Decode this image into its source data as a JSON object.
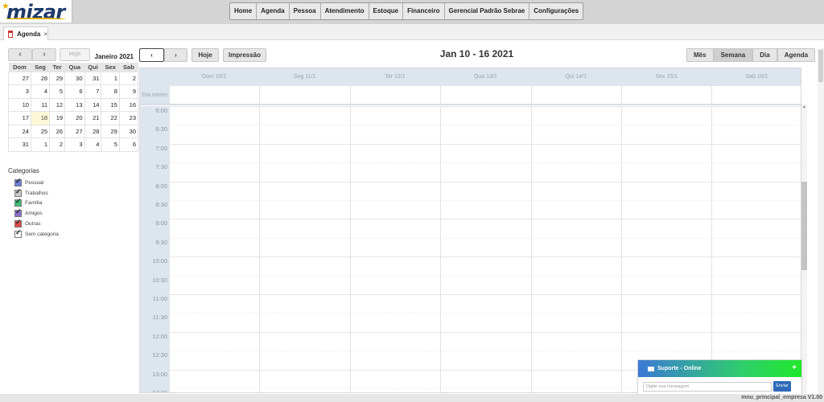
{
  "logo": {
    "text": "mizar"
  },
  "menu": [
    "Home",
    "Agenda",
    "Pessoa",
    "Atendimento",
    "Estoque",
    "Financeiro",
    "Gerencial Padrão Sebrae",
    "Configurações"
  ],
  "tab": {
    "label": "Agenda",
    "close": "×"
  },
  "mini_calendar": {
    "prev": "‹",
    "next": "›",
    "today": "Hoje",
    "title": "Janeiro 2021",
    "weekdays": [
      "Dom",
      "Seg",
      "Ter",
      "Qua",
      "Qui",
      "Sex",
      "Sab"
    ],
    "weeks": [
      [
        "27",
        "28",
        "29",
        "30",
        "31",
        "1",
        "2"
      ],
      [
        "3",
        "4",
        "5",
        "6",
        "7",
        "8",
        "9"
      ],
      [
        "10",
        "11",
        "12",
        "13",
        "14",
        "15",
        "16"
      ],
      [
        "17",
        "18",
        "19",
        "20",
        "21",
        "22",
        "23"
      ],
      [
        "24",
        "25",
        "26",
        "27",
        "28",
        "29",
        "30"
      ],
      [
        "31",
        "1",
        "2",
        "3",
        "4",
        "5",
        "6"
      ]
    ]
  },
  "categories": {
    "title": "Categorias",
    "items": [
      {
        "label": "Pessoal",
        "color": "#6a7fd6"
      },
      {
        "label": "Trabalhos",
        "color": "#c9c9c9"
      },
      {
        "label": "Família",
        "color": "#3ec07a"
      },
      {
        "label": "Amigos",
        "color": "#8a6fd0"
      },
      {
        "label": "Outras",
        "color": "#e04a4a"
      },
      {
        "label": "Sem categoria",
        "color": "#ffffff"
      }
    ]
  },
  "toolbar": {
    "prev": "‹",
    "next": "›",
    "today": "Hoje",
    "print": "Impressão",
    "title": "Jan 10 - 16 2021",
    "views": [
      "Mês",
      "Semana",
      "Dia",
      "Agenda"
    ],
    "active_view": "Semana"
  },
  "week": {
    "days": [
      "Dom 10/1",
      "Seg 11/1",
      "Ter 12/1",
      "Qua 13/1",
      "Qui 14/1",
      "Sex 15/1",
      "Sab 16/1"
    ],
    "allday_label": "Dia inteiro",
    "times": [
      "6:00",
      "6:30",
      "7:00",
      "7:30",
      "8:00",
      "8:30",
      "9:00",
      "9:30",
      "10:00",
      "10:30",
      "11:00",
      "11:30",
      "12:00",
      "12:30",
      "13:00",
      "13:30"
    ]
  },
  "support": {
    "title": "Suporte - Online",
    "plus": "+",
    "placeholder": "Digite sua mensagem",
    "send": "Enviar"
  },
  "status": {
    "text": "mnu_principal_empresa V1.00"
  }
}
